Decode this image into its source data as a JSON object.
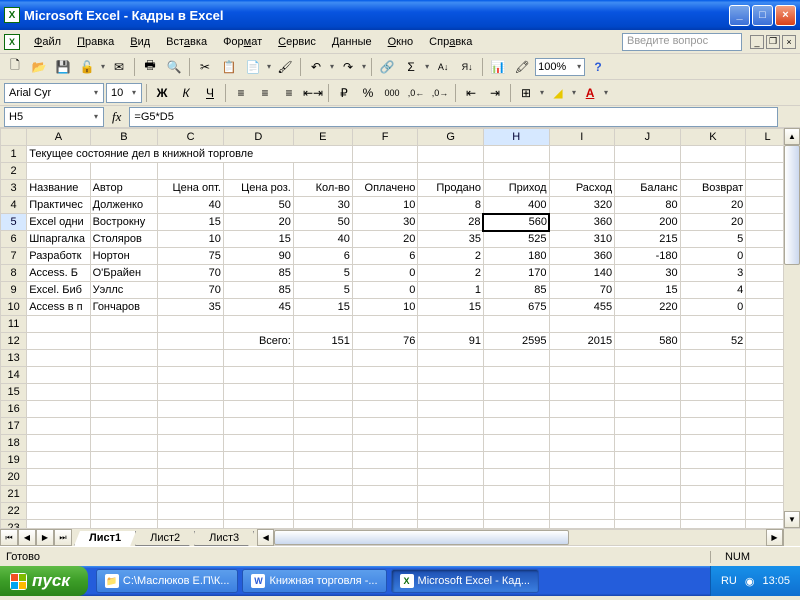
{
  "window": {
    "title": "Microsoft Excel - Кадры в Excel"
  },
  "menu": {
    "file": "Файл",
    "edit": "Правка",
    "view": "Вид",
    "insert": "Вставка",
    "format": "Формат",
    "tools": "Сервис",
    "data": "Данные",
    "window": "Окно",
    "help": "Справка",
    "ask_placeholder": "Введите вопрос"
  },
  "toolbar": {
    "zoom": "100%"
  },
  "format": {
    "font": "Arial Cyr",
    "size": "10"
  },
  "formulaBar": {
    "nameBox": "H5",
    "formula": "=G5*D5"
  },
  "columns": [
    "A",
    "B",
    "C",
    "D",
    "E",
    "F",
    "G",
    "H",
    "I",
    "J",
    "K",
    "L"
  ],
  "rowNums": [
    1,
    2,
    3,
    4,
    5,
    6,
    7,
    8,
    9,
    10,
    11,
    12,
    13,
    14,
    15,
    16,
    17,
    18,
    19,
    20,
    21,
    22,
    23
  ],
  "selectedCell": {
    "row": 5,
    "col": "H"
  },
  "cells": {
    "A1": "Текущее состояние дел в книжной торговле",
    "A3": "Название",
    "B3": "Автор",
    "C3": "Цена опт.",
    "D3": "Цена роз.",
    "E3": "Кол-во",
    "F3": "Оплачено",
    "G3": "Продано",
    "H3": "Приход",
    "I3": "Расход",
    "J3": "Баланс",
    "K3": "Возврат",
    "A4": "Практичес",
    "B4": "Долженко",
    "C4": "40",
    "D4": "50",
    "E4": "30",
    "F4": "10",
    "G4": "8",
    "H4": "400",
    "I4": "320",
    "J4": "80",
    "K4": "20",
    "A5": "Excel одни",
    "B5": "Вострокну",
    "C5": "15",
    "D5": "20",
    "E5": "50",
    "F5": "30",
    "G5": "28",
    "H5": "560",
    "I5": "360",
    "J5": "200",
    "K5": "20",
    "A6": "Шпаргалка",
    "B6": "Столяров",
    "C6": "10",
    "D6": "15",
    "E6": "40",
    "F6": "20",
    "G6": "35",
    "H6": "525",
    "I6": "310",
    "J6": "215",
    "K6": "5",
    "A7": "Разработк",
    "B7": "Нортон",
    "C7": "75",
    "D7": "90",
    "E7": "6",
    "F7": "6",
    "G7": "2",
    "H7": "180",
    "I7": "360",
    "J7": "-180",
    "K7": "0",
    "A8": "Access. Б",
    "B8": "О'Брайен",
    "C8": "70",
    "D8": "85",
    "E8": "5",
    "F8": "0",
    "G8": "2",
    "H8": "170",
    "I8": "140",
    "J8": "30",
    "K8": "3",
    "A9": "Excel. Биб",
    "B9": "Уэллс",
    "C9": "70",
    "D9": "85",
    "E9": "5",
    "F9": "0",
    "G9": "1",
    "H9": "85",
    "I9": "70",
    "J9": "15",
    "K9": "4",
    "A10": "Access в п",
    "B10": "Гончаров",
    "C10": "35",
    "D10": "45",
    "E10": "15",
    "F10": "10",
    "G10": "15",
    "H10": "675",
    "I10": "455",
    "J10": "220",
    "K10": "0",
    "D12": "Всего:",
    "E12": "151",
    "F12": "76",
    "G12": "91",
    "H12": "2595",
    "I12": "2015",
    "J12": "580",
    "K12": "52"
  },
  "numericCols": [
    "C",
    "D",
    "E",
    "F",
    "G",
    "H",
    "I",
    "J",
    "K"
  ],
  "tabs": {
    "active": "Лист1",
    "list": [
      "Лист1",
      "Лист2",
      "Лист3"
    ]
  },
  "status": {
    "ready": "Готово",
    "num": "NUM"
  },
  "taskbar": {
    "start": "пуск",
    "items": [
      {
        "icon": "📁",
        "iconColor": "#f0c010",
        "label": "С:\\Маслюков Е.П\\К..."
      },
      {
        "icon": "W",
        "iconColor": "#2a5bd7",
        "label": "Книжная торговля -..."
      },
      {
        "icon": "X",
        "iconColor": "#0a6b0a",
        "label": "Microsoft Excel - Кад..."
      }
    ],
    "activeIndex": 2,
    "lang": "RU",
    "clock": "13:05"
  }
}
